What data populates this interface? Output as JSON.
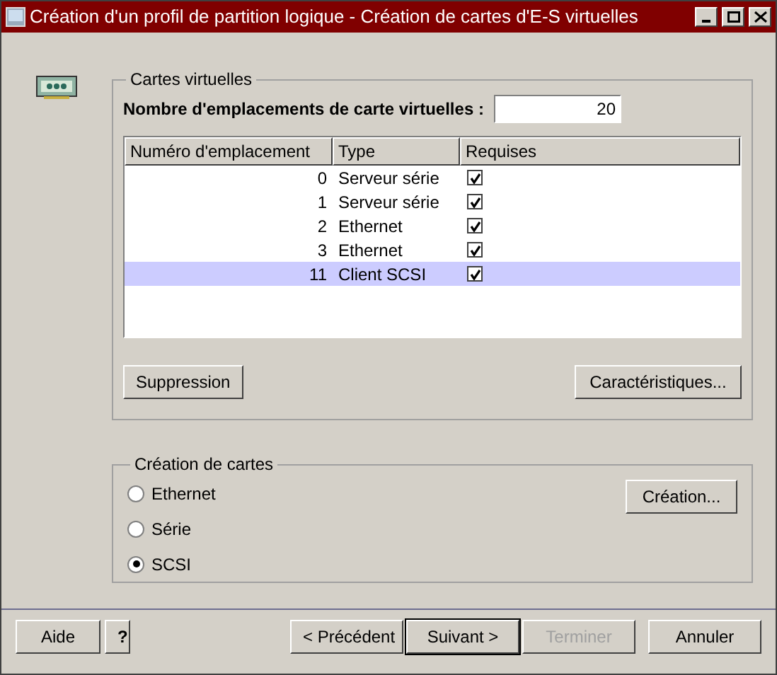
{
  "window": {
    "title": "Création d'un profil de partition logique - Création de cartes d'E-S virtuelles"
  },
  "virtual_cards": {
    "legend": "Cartes virtuelles",
    "slots_label": "Nombre d'emplacements de carte virtuelles :",
    "slots_value": "20",
    "table": {
      "columns": [
        "Numéro d'emplacement",
        "Type",
        "Requises"
      ],
      "rows": [
        {
          "slot": "0",
          "type": "Serveur série",
          "required": true,
          "selected": false
        },
        {
          "slot": "1",
          "type": "Serveur série",
          "required": true,
          "selected": false
        },
        {
          "slot": "2",
          "type": "Ethernet",
          "required": true,
          "selected": false
        },
        {
          "slot": "3",
          "type": "Ethernet",
          "required": true,
          "selected": false
        },
        {
          "slot": "11",
          "type": "Client SCSI",
          "required": true,
          "selected": true
        }
      ]
    },
    "buttons": [
      "Suppression",
      "Caractéristiques..."
    ]
  },
  "create_cards": {
    "legend": "Création de cartes",
    "options": [
      {
        "label": "Ethernet",
        "selected": false
      },
      {
        "label": "Série",
        "selected": false
      },
      {
        "label": "SCSI",
        "selected": true
      }
    ],
    "button": "Création..."
  },
  "footer": {
    "help": "Aide",
    "help_icon": "?",
    "buttons": [
      {
        "label": "< Précédent",
        "disabled": false,
        "default": false
      },
      {
        "label": "Suivant >",
        "disabled": false,
        "default": true
      },
      {
        "label": "Terminer",
        "disabled": true,
        "default": false
      },
      {
        "label": "Annuler",
        "disabled": false,
        "default": false
      }
    ]
  }
}
